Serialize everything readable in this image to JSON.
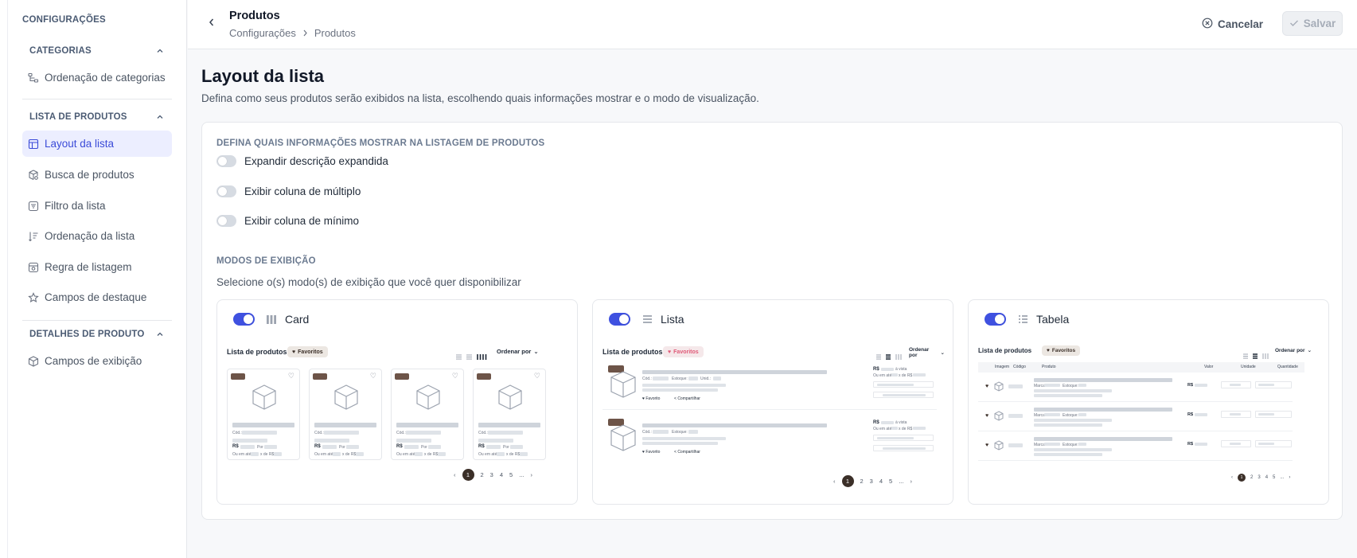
{
  "sidebar": {
    "title": "CONFIGURAÇÕES",
    "sections": [
      {
        "label": "CATEGORIAS",
        "items": [
          {
            "label": "Ordenação de categorias",
            "icon": "hierarchy-icon"
          }
        ]
      },
      {
        "label": "LISTA DE PRODUTOS",
        "items": [
          {
            "label": "Layout da lista",
            "icon": "layout-icon",
            "active": true
          },
          {
            "label": "Busca de produtos",
            "icon": "package-search-icon"
          },
          {
            "label": "Filtro da lista",
            "icon": "filter-icon"
          },
          {
            "label": "Ordenação da lista",
            "icon": "sort-icon"
          },
          {
            "label": "Regra de listagem",
            "icon": "rule-icon"
          },
          {
            "label": "Campos de destaque",
            "icon": "star-icon"
          }
        ]
      },
      {
        "label": "DETALHES DE PRODUTO",
        "items": [
          {
            "label": "Campos de exibição",
            "icon": "box-icon"
          }
        ]
      }
    ]
  },
  "header": {
    "title": "Produtos",
    "breadcrumb": [
      "Configurações",
      "Produtos"
    ],
    "cancel_label": "Cancelar",
    "save_label": "Salvar"
  },
  "main": {
    "title": "Layout da lista",
    "description": "Defina como seus produtos serão exibidos na lista, escolhendo quais informações mostrar e o modo de visualização.",
    "info_section_label": "DEFINA QUAIS INFORMAÇÕES MOSTRAR NA LISTAGEM DE PRODUTOS",
    "toggles": [
      {
        "label": "Expandir descrição expandida",
        "on": false
      },
      {
        "label": "Exibir coluna de múltiplo",
        "on": false
      },
      {
        "label": "Exibir coluna de mínimo",
        "on": false
      }
    ],
    "modes_label": "MODOS DE EXIBIÇÃO",
    "modes_help": "Selecione o(s) modo(s) de exibição que você quer disponibilizar",
    "modes": [
      {
        "label": "Card",
        "on": true,
        "icon": "columns-icon"
      },
      {
        "label": "Lista",
        "on": true,
        "icon": "list-icon"
      },
      {
        "label": "Tabela",
        "on": true,
        "icon": "table-icon"
      }
    ]
  },
  "preview": {
    "title": "Lista de produtos",
    "favorites": "Favoritos",
    "sort": "Ordenar por",
    "pages": [
      "1",
      "2",
      "3",
      "4",
      "5",
      "..."
    ],
    "cod": "Cód.:",
    "currency": "R$",
    "por": "Por",
    "ou_em_ate": "Ou em até",
    "x_de": "x de R$",
    "a_vista": "à vista",
    "estoque": "Estoque:",
    "unid": "Unid.:",
    "marca": "Marca",
    "favorito": "Favorito",
    "compartilhar": "Compartilhar",
    "table_headers": [
      "Imagem",
      "Código",
      "Produto",
      "Valor",
      "Unidade",
      "Quantidade"
    ]
  },
  "colors": {
    "accent": "#3f51e0",
    "active_bg": "#eceeff",
    "brown": "#3b2f28"
  }
}
